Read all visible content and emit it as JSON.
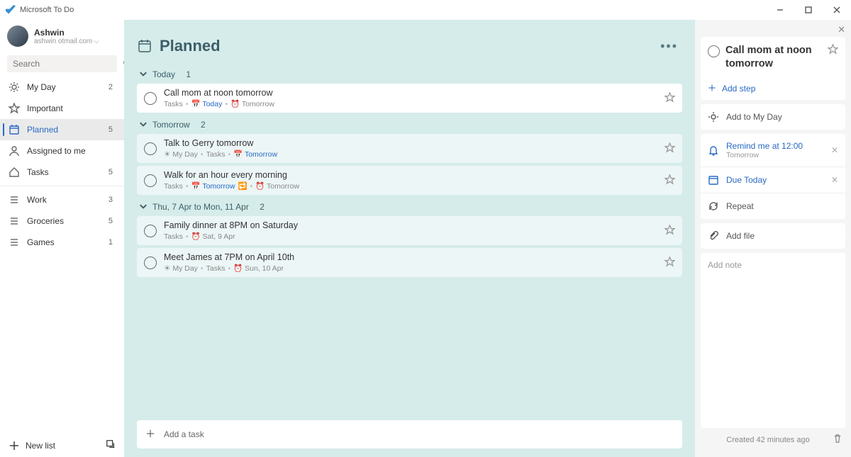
{
  "titlebar": {
    "appName": "Microsoft To Do"
  },
  "profile": {
    "name": "Ashwin",
    "email": "ashwin        otmail.com"
  },
  "search": {
    "placeholder": "Search"
  },
  "nav": {
    "myDay": {
      "label": "My Day"
    },
    "important": {
      "label": "Important"
    },
    "planned": {
      "label": "Planned",
      "count": "5"
    },
    "assigned": {
      "label": "Assigned to me"
    },
    "tasks": {
      "label": "Tasks",
      "count": "5"
    },
    "lists": [
      {
        "label": "Work",
        "count": "3"
      },
      {
        "label": "Groceries",
        "count": "5"
      },
      {
        "label": "Games",
        "count": "1"
      }
    ]
  },
  "newList": {
    "label": "New list"
  },
  "main": {
    "title": "Planned",
    "groups": [
      {
        "label": "Today",
        "count": "1",
        "tasks": [
          {
            "title": "Call mom at noon tomorrow",
            "metaParts": [
              "Tasks",
              "•",
              "📅 Today",
              "•",
              "⏰ Tomorrow"
            ],
            "bg": "white"
          }
        ]
      },
      {
        "label": "Tomorrow",
        "count": "2",
        "tasks": [
          {
            "title": "Talk to Gerry tomorrow",
            "metaParts": [
              "☀ My Day",
              "•",
              "Tasks",
              "•",
              "📅 Tomorrow"
            ],
            "bg": "alt"
          },
          {
            "title": "Walk for an hour every morning",
            "metaParts": [
              "Tasks",
              "•",
              "📅 Tomorrow",
              "🔁",
              "•",
              "⏰ Tomorrow"
            ],
            "bg": "alt"
          }
        ]
      },
      {
        "label": "Thu, 7 Apr to Mon, 11 Apr",
        "count": "2",
        "tasks": [
          {
            "title": "Family dinner at 8PM on Saturday",
            "metaParts": [
              "Tasks",
              "•",
              "⏰ Sat, 9 Apr"
            ],
            "bg": "alt"
          },
          {
            "title": "Meet James at 7PM on April 10th",
            "metaParts": [
              "☀ My Day",
              "•",
              "Tasks",
              "•",
              "⏰ Sun, 10 Apr"
            ],
            "bg": "alt"
          }
        ]
      }
    ],
    "addTask": "Add a task"
  },
  "detail": {
    "title": "Call mom at noon tomorrow",
    "addStep": "Add step",
    "addToMyDay": "Add to My Day",
    "reminder": {
      "label": "Remind me at 12:00",
      "sub": "Tomorrow"
    },
    "due": "Due Today",
    "repeat": "Repeat",
    "addFile": "Add file",
    "note": "Add note",
    "created": "Created 42 minutes ago"
  }
}
